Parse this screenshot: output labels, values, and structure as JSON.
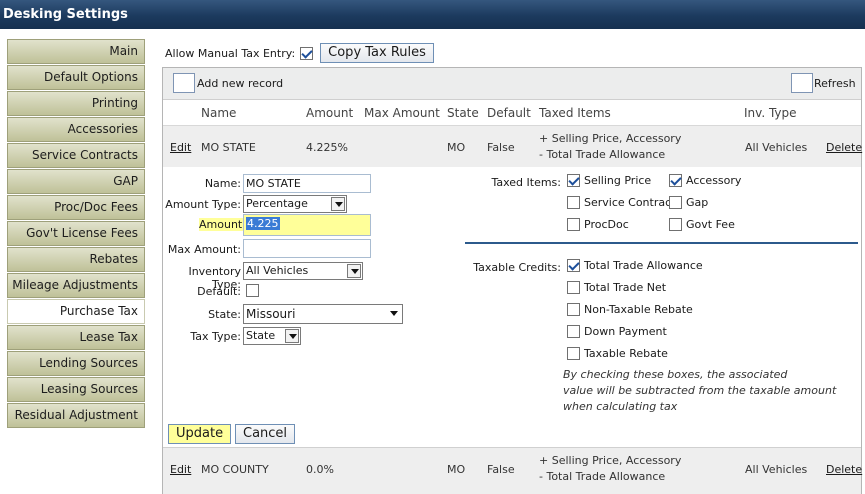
{
  "window": {
    "title": "Desking Settings"
  },
  "sidebar": {
    "items": [
      {
        "label": "Main"
      },
      {
        "label": "Default Options"
      },
      {
        "label": "Printing"
      },
      {
        "label": "Accessories"
      },
      {
        "label": "Service Contracts"
      },
      {
        "label": "GAP"
      },
      {
        "label": "Proc/Doc Fees"
      },
      {
        "label": "Gov't License Fees"
      },
      {
        "label": "Rebates"
      },
      {
        "label": "Mileage Adjustments"
      },
      {
        "label": "Purchase Tax",
        "active": true
      },
      {
        "label": "Lease Tax"
      },
      {
        "label": "Lending Sources"
      },
      {
        "label": "Leasing Sources"
      },
      {
        "label": "Residual Adjustment"
      }
    ]
  },
  "topbar": {
    "manual_tax_label": "Allow Manual Tax Entry:",
    "manual_tax_checked": true,
    "copy_button": "Copy Tax Rules"
  },
  "toolbar": {
    "add_label": "Add new record",
    "refresh_label": "Refresh"
  },
  "table": {
    "headers": [
      "Name",
      "Amount",
      "Max Amount",
      "State",
      "Default",
      "Taxed Items",
      "Inv. Type"
    ],
    "rows": [
      {
        "edit": "Edit",
        "name": "MO STATE",
        "amount": "4.225%",
        "max_amount": "",
        "state": "MO",
        "default": "False",
        "taxed_line1": "+ Selling Price, Accessory",
        "taxed_line2": "- Total Trade Allowance",
        "inv_type": "All Vehicles",
        "delete": "Delete"
      },
      {
        "edit": "Edit",
        "name": "MO COUNTY",
        "amount": "0.0%",
        "max_amount": "",
        "state": "MO",
        "default": "False",
        "taxed_line1": "+ Selling Price, Accessory",
        "taxed_line2": "- Total Trade Allowance",
        "inv_type": "All Vehicles",
        "delete": "Delete"
      }
    ]
  },
  "form": {
    "name_label": "Name:",
    "name_value": "MO STATE",
    "amount_type_label": "Amount Type:",
    "amount_type_value": "Percentage",
    "amount_label": "Amount:",
    "amount_value": "4.225",
    "max_amount_label": "Max Amount:",
    "max_amount_value": "",
    "inventory_type_label": "Inventory Type:",
    "inventory_type_value": "All Vehicles",
    "default_label": "Default:",
    "default_checked": false,
    "state_label": "State:",
    "state_value": "Missouri",
    "tax_type_label": "Tax Type:",
    "tax_type_value": "State",
    "taxed_items_label": "Taxed Items:",
    "taxed_items": [
      {
        "label": "Selling Price",
        "checked": true
      },
      {
        "label": "Accessory",
        "checked": true
      },
      {
        "label": "Service Contract",
        "checked": false
      },
      {
        "label": "Gap",
        "checked": false
      },
      {
        "label": "ProcDoc",
        "checked": false
      },
      {
        "label": "Govt Fee",
        "checked": false
      }
    ],
    "taxable_credits_label": "Taxable Credits:",
    "taxable_credits": [
      {
        "label": "Total Trade Allowance",
        "checked": true
      },
      {
        "label": "Total Trade Net",
        "checked": false
      },
      {
        "label": "Non-Taxable Rebate",
        "checked": false
      },
      {
        "label": "Down Payment",
        "checked": false
      },
      {
        "label": "Taxable Rebate",
        "checked": false
      }
    ],
    "note_line1": "By checking these boxes, the associated",
    "note_line2": "value will be subtracted from the taxable amount",
    "note_line3": "when calculating tax",
    "update_button": "Update",
    "cancel_button": "Cancel"
  },
  "colors": {
    "titlebar": "#1c3a5e",
    "sidebar": "#c9cba6",
    "highlight": "#ffff99",
    "divider": "#2c5a8c"
  }
}
